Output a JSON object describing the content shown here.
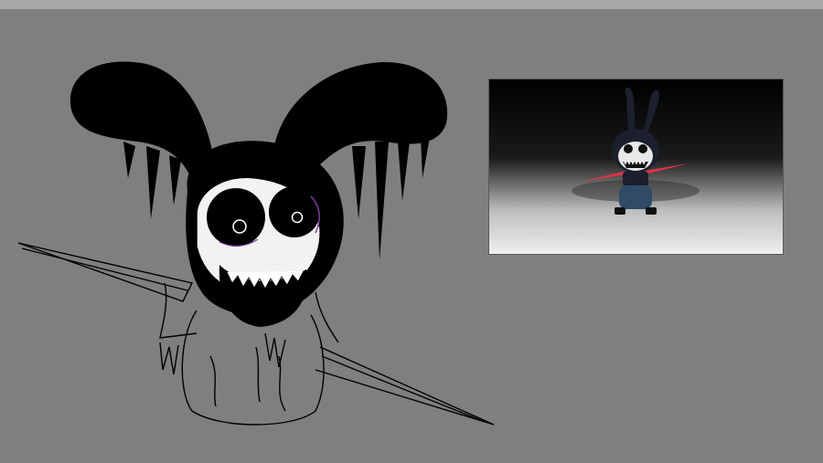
{
  "canvas": {
    "background": "#7f7f7f",
    "topbar_color": "#a8a8a8"
  },
  "sketch": {
    "subject": "ink-sketch-rabbit-creature",
    "ink_color": "#000000",
    "eye_highlight": "#ffffff",
    "eye_accent": "#7a3fa0"
  },
  "reference_render": {
    "subject": "3d-rabbit-character-render",
    "background_top": "#000000",
    "floor_color": "#f0f0f0",
    "accent_spikes": "#e0334a"
  }
}
